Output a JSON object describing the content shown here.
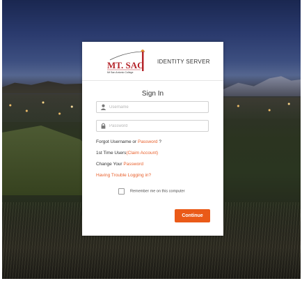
{
  "header": {
    "logo_title": "MT. SAC",
    "logo_subtitle": "Mt San Antonio College",
    "title": "IDENTITY SERVER"
  },
  "form": {
    "heading": "Sign In",
    "username_placeholder": "Username",
    "password_placeholder": "Password",
    "username_icon": "user-icon",
    "password_icon": "lock-icon"
  },
  "links": {
    "forgot_prefix": "Forgot Username or",
    "forgot_link": "Password",
    "forgot_suffix": "?",
    "first_time_prefix": "1st Time Users",
    "first_time_link": "(Claim Account)",
    "change_prefix": "Change Your",
    "change_link": "Password",
    "trouble_link": "Having Trouble Logging in?"
  },
  "remember_label": "Remember me on this computer",
  "continue_label": "Continue",
  "colors": {
    "accent": "#e8602c",
    "button": "#ea5a18",
    "logo_red": "#b5252b"
  }
}
